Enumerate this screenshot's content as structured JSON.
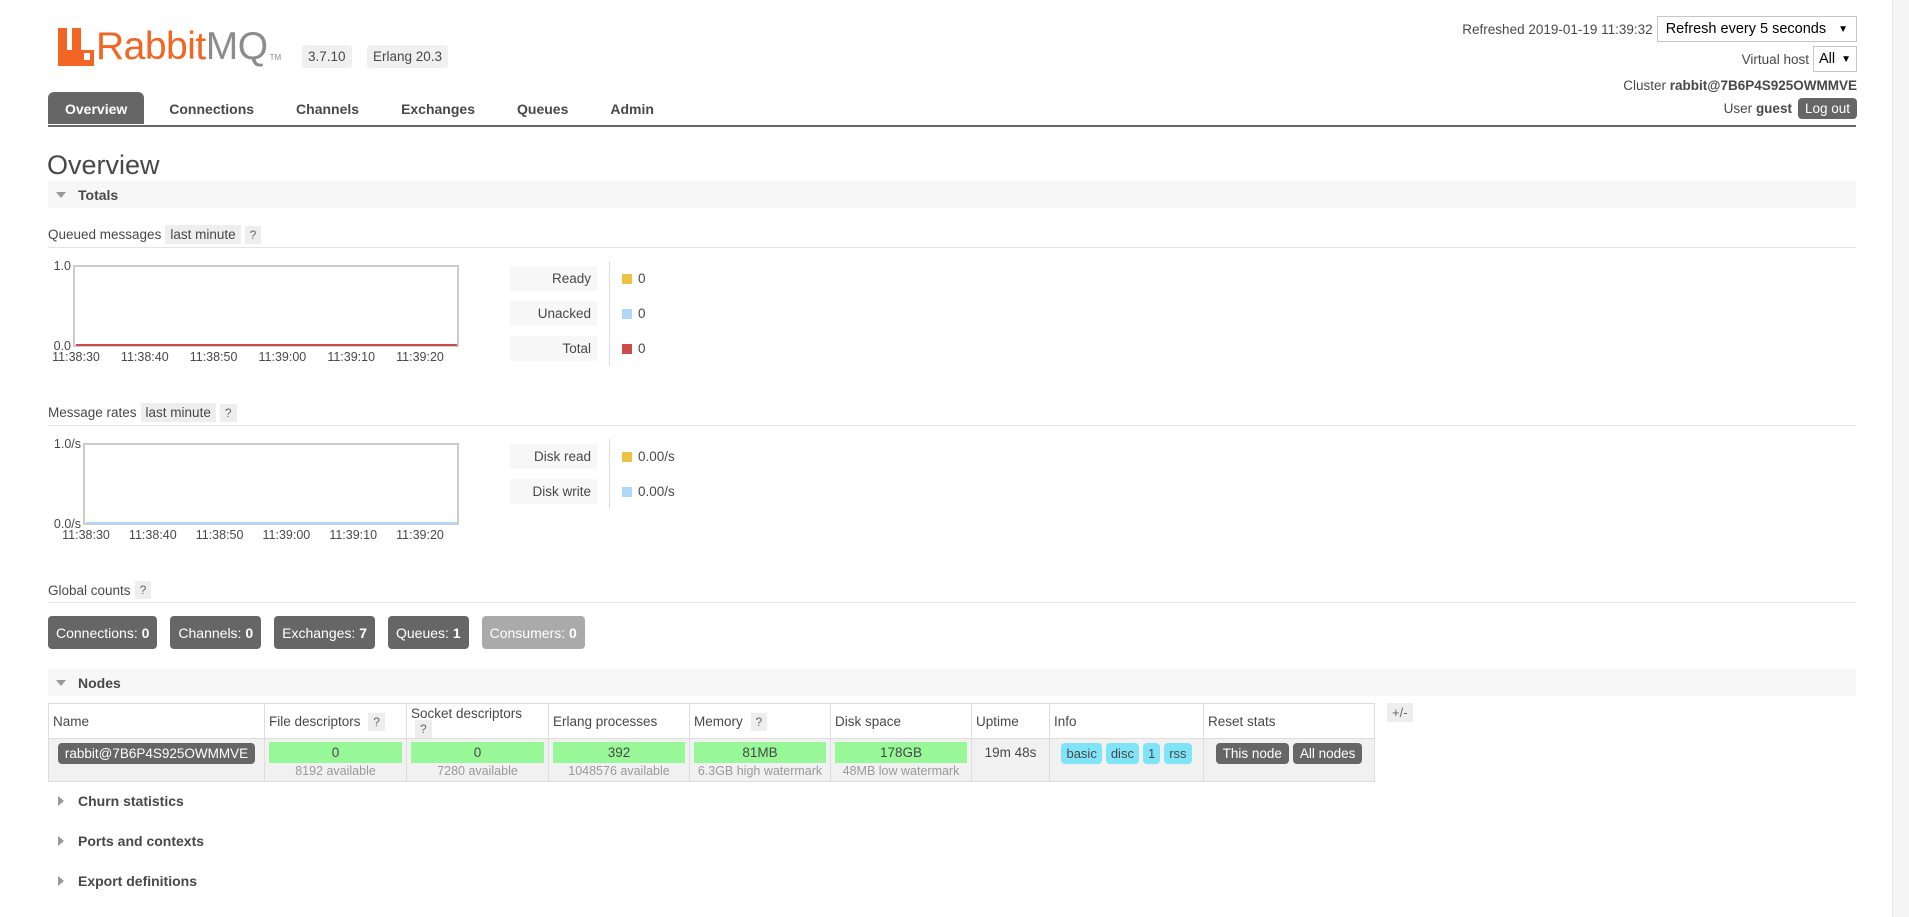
{
  "brand": {
    "word1": "Rabbit",
    "word2": "MQ",
    "tm": "TM"
  },
  "version": "3.7.10",
  "erlang": "Erlang 20.3",
  "status": {
    "refreshed_label": "Refreshed 2019-01-19 11:39:32",
    "refresh_select": "Refresh every 5 seconds",
    "vhost_label": "Virtual host",
    "vhost_select": "All",
    "cluster_label": "Cluster",
    "cluster_name": "rabbit@7B6P4S925OWMMVE",
    "user_label": "User",
    "user_name": "guest",
    "logout": "Log out"
  },
  "tabs": [
    "Overview",
    "Connections",
    "Channels",
    "Exchanges",
    "Queues",
    "Admin"
  ],
  "page_title": "Overview",
  "totals": {
    "title": "Totals",
    "queued": {
      "label": "Queued messages",
      "range": "last minute",
      "help": "?"
    },
    "rates": {
      "label": "Message rates",
      "range": "last minute",
      "help": "?"
    }
  },
  "queued_legend": [
    {
      "label": "Ready",
      "value": "0",
      "color": "#edc240"
    },
    {
      "label": "Unacked",
      "value": "0",
      "color": "#afd8f8"
    },
    {
      "label": "Total",
      "value": "0",
      "color": "#cb4b4b"
    }
  ],
  "rates_legend": [
    {
      "label": "Disk read",
      "value": "0.00/s",
      "color": "#edc240"
    },
    {
      "label": "Disk write",
      "value": "0.00/s",
      "color": "#afd8f8"
    }
  ],
  "chart_data": [
    {
      "type": "line",
      "title": "Queued messages",
      "x": [
        "11:38:30",
        "11:38:40",
        "11:38:50",
        "11:39:00",
        "11:39:10",
        "11:39:20"
      ],
      "y_ticks": [
        "0.0",
        "1.0"
      ],
      "ylim": [
        0,
        1
      ],
      "series": [
        {
          "name": "Ready",
          "values": [
            0,
            0,
            0,
            0,
            0,
            0
          ],
          "color": "#edc240"
        },
        {
          "name": "Unacked",
          "values": [
            0,
            0,
            0,
            0,
            0,
            0
          ],
          "color": "#afd8f8"
        },
        {
          "name": "Total",
          "values": [
            0,
            0,
            0,
            0,
            0,
            0
          ],
          "color": "#cb4b4b"
        }
      ]
    },
    {
      "type": "line",
      "title": "Message rates",
      "x": [
        "11:38:30",
        "11:38:40",
        "11:38:50",
        "11:39:00",
        "11:39:10",
        "11:39:20"
      ],
      "y_ticks": [
        "0.0/s",
        "1.0/s"
      ],
      "ylim": [
        0,
        1
      ],
      "series": [
        {
          "name": "Disk read",
          "values": [
            0,
            0,
            0,
            0,
            0,
            0
          ],
          "color": "#edc240"
        },
        {
          "name": "Disk write",
          "values": [
            0,
            0,
            0,
            0,
            0,
            0
          ],
          "color": "#afd8f8"
        }
      ]
    }
  ],
  "global_counts": {
    "label": "Global counts",
    "help": "?",
    "items": [
      {
        "label": "Connections:",
        "value": "0"
      },
      {
        "label": "Channels:",
        "value": "0"
      },
      {
        "label": "Exchanges:",
        "value": "7"
      },
      {
        "label": "Queues:",
        "value": "1"
      },
      {
        "label": "Consumers:",
        "value": "0"
      }
    ]
  },
  "nodes": {
    "title": "Nodes",
    "toggle": "+/-",
    "columns": {
      "name": "Name",
      "fd": "File descriptors",
      "sd": "Socket descriptors",
      "erl": "Erlang processes",
      "mem": "Memory",
      "disk": "Disk space",
      "uptime": "Uptime",
      "info": "Info",
      "reset": "Reset stats",
      "help": "?"
    },
    "row": {
      "name": "rabbit@7B6P4S925OWMMVE",
      "fd": "0",
      "fd_sub": "8192 available",
      "sd": "0",
      "sd_sub": "7280 available",
      "erl": "392",
      "erl_sub": "1048576 available",
      "mem": "81MB",
      "mem_sub": "6.3GB high watermark",
      "disk": "178GB",
      "disk_sub": "48MB low watermark",
      "uptime": "19m 48s",
      "info": [
        "basic",
        "disc",
        "1",
        "rss"
      ],
      "reset_this": "This node",
      "reset_all": "All nodes"
    }
  },
  "collapsed_sections": [
    "Churn statistics",
    "Ports and contexts",
    "Export definitions"
  ]
}
